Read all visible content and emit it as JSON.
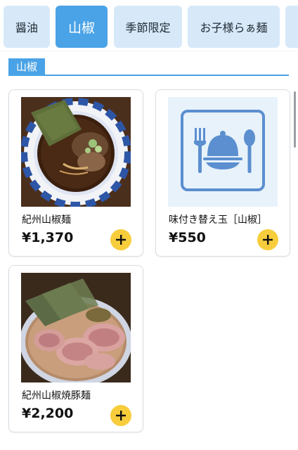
{
  "tabs": [
    {
      "label": "醤油",
      "active": false
    },
    {
      "label": "山椒",
      "active": true
    },
    {
      "label": "季節限定",
      "active": false
    },
    {
      "label": "お子様らぁ麺",
      "active": false
    }
  ],
  "section": {
    "title": "山椒"
  },
  "items": [
    {
      "name": "紀州山椒麺",
      "price": "¥1,370",
      "image": "ramen-dark-broth-photo"
    },
    {
      "name": "味付き替え玉［山椒］",
      "price": "¥550",
      "image": "plate-icon-placeholder"
    },
    {
      "name": "紀州山椒焼豚麺",
      "price": "¥2,200",
      "image": "chashu-ramen-photo"
    }
  ],
  "colors": {
    "accent": "#4aa3e6",
    "tab_bg": "#d7e9f9",
    "add_button": "#f7cd3c"
  }
}
